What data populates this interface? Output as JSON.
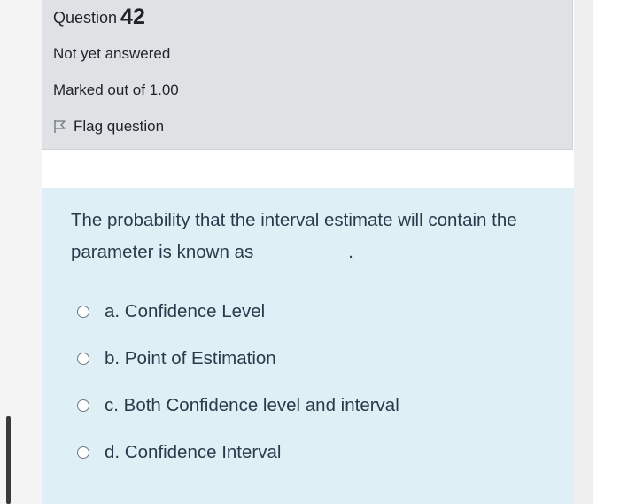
{
  "question": {
    "label": "Question",
    "number": "42",
    "status": "Not yet answered",
    "marks": "Marked out of 1.00",
    "flag_label": "Flag question",
    "text": "The probability that the interval estimate will contain the parameter is known as",
    "text_suffix": "."
  },
  "options": [
    {
      "label": "a. Confidence Level"
    },
    {
      "label": "b. Point of Estimation"
    },
    {
      "label": "c. Both Confidence level and interval"
    },
    {
      "label": "d. Confidence Interval"
    }
  ],
  "icons": {
    "flag": "flag-icon",
    "radio": "radio-button-icon"
  },
  "colors": {
    "info_bg": "#dfe1e5",
    "content_bg": "#def0f6",
    "text": "#2b3a4a"
  }
}
